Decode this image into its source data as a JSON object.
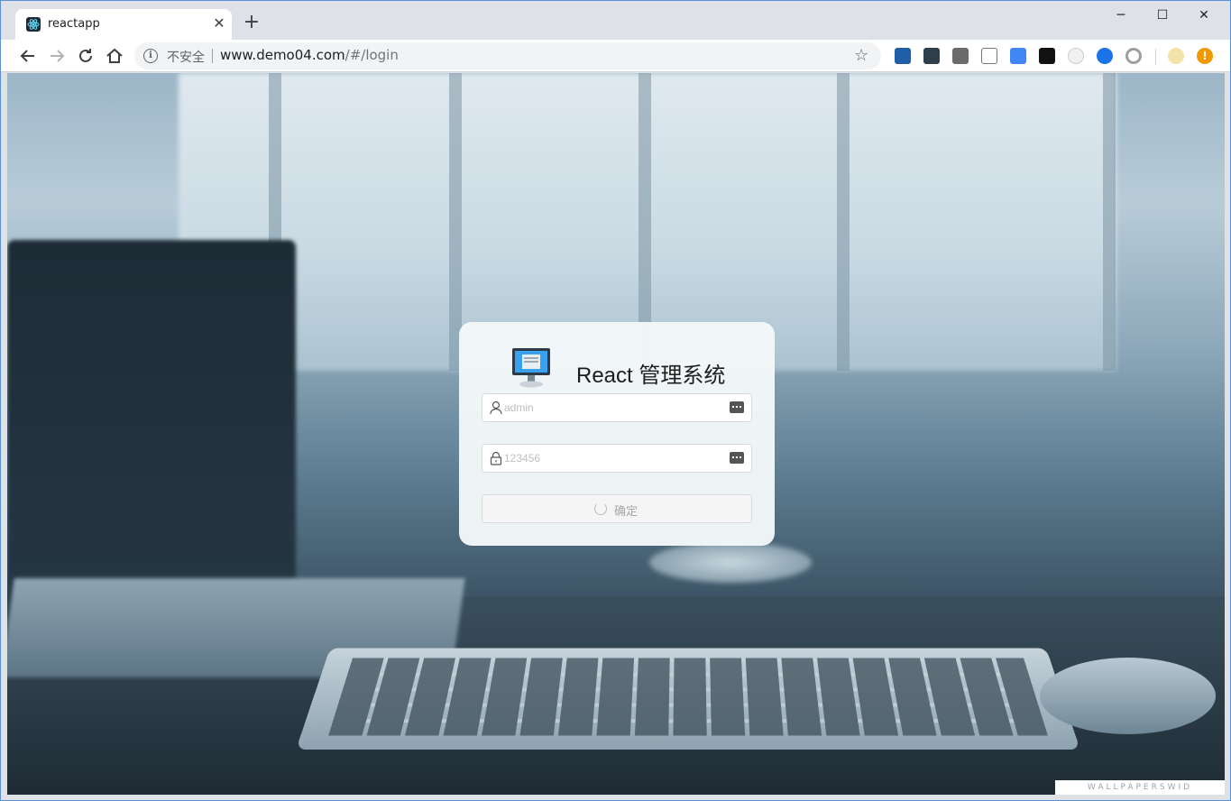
{
  "browser": {
    "tab_title": "reactapp",
    "tab_close": "✕",
    "new_tab": "+",
    "window_controls": {
      "minimize": "─",
      "maximize": "☐",
      "close": "✕"
    },
    "security_label": "不安全",
    "url_host": "www.demo04.com",
    "url_path": "/#/login",
    "bookmark_star": "☆",
    "extension_icons": [
      "s-extension-icon",
      "dots-extension-icon",
      "gmail-checker-icon",
      "eyedropper-icon",
      "translate-icon",
      "react-devtools-icon",
      "ghost-extension-icon",
      "blue-circle-extension-icon",
      "gray-circle-extension-icon",
      "profile-avatar-icon",
      "warning-icon"
    ]
  },
  "login": {
    "title": "React 管理系统",
    "username_placeholder": "admin",
    "password_placeholder": "123456",
    "submit_label": "确定"
  },
  "watermark": "WALLPAPERSWID",
  "colors": {
    "accent_blue": "#1a73e8",
    "card_bg": "#f4f8f9",
    "warning": "#f29900"
  }
}
